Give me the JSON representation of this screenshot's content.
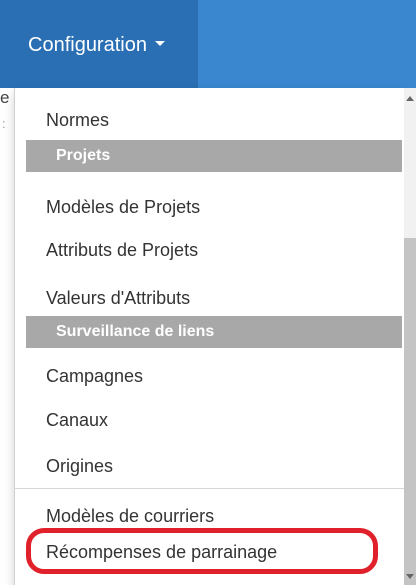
{
  "navbar": {
    "menu_label": "Configuration",
    "caret_icon": "caret-down-icon"
  },
  "background": {
    "fragment_1": "e",
    "fragment_2": ":"
  },
  "dropdown": {
    "items": [
      {
        "label": "Normes"
      },
      {
        "label": "Modèles de Projets"
      },
      {
        "label": "Attributs de Projets"
      },
      {
        "label": "Valeurs d'Attributs"
      },
      {
        "label": "Campagnes"
      },
      {
        "label": "Canaux"
      },
      {
        "label": "Origines"
      },
      {
        "label": "Modèles de courriers"
      },
      {
        "label": "Récompenses de parrainage"
      }
    ],
    "headers": [
      {
        "label": "Projets"
      },
      {
        "label": "Surveillance de liens"
      }
    ]
  },
  "colors": {
    "navbar": "#3a87d0",
    "navbar_active": "#2a6fb4",
    "section_header": "#a8a8a8",
    "highlight": "#e0202a"
  }
}
